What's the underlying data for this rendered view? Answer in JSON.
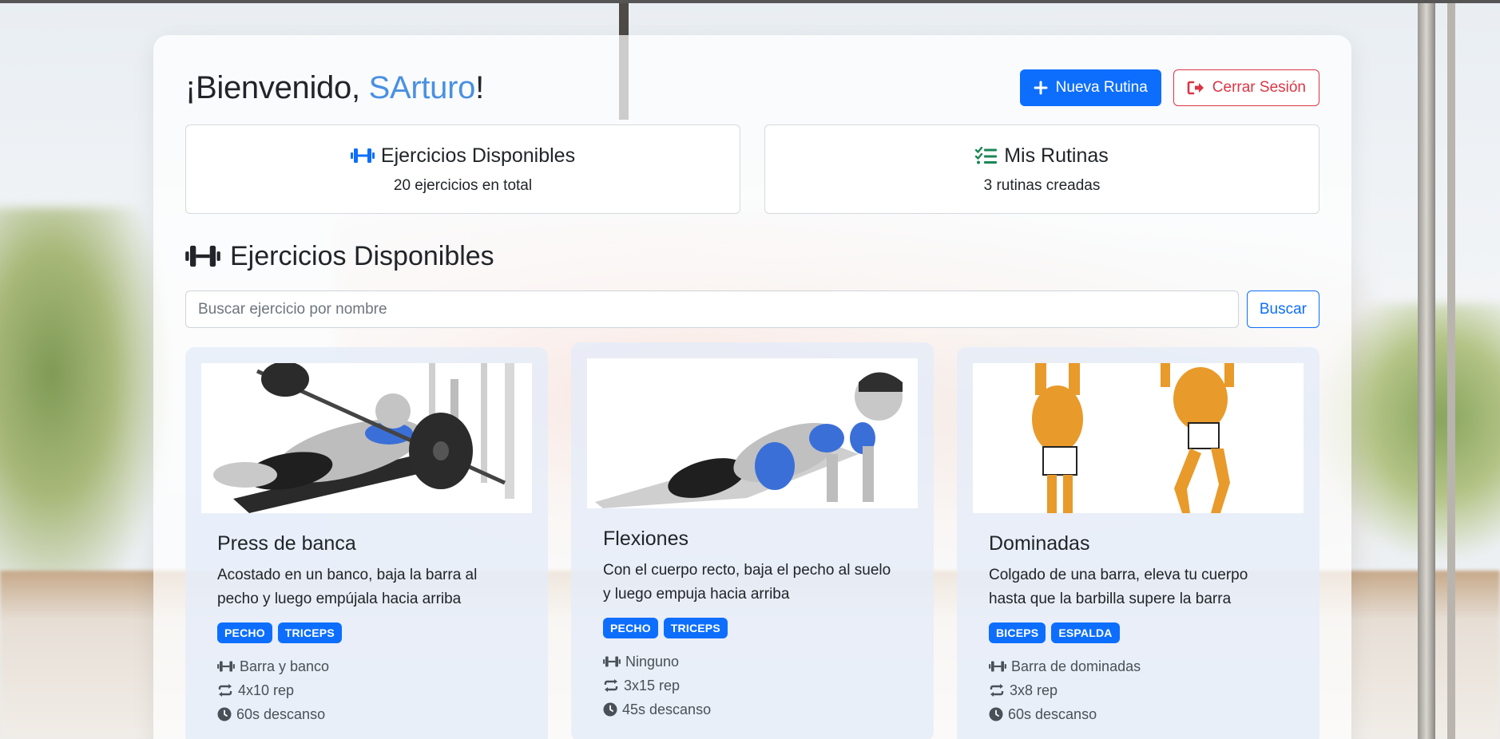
{
  "header": {
    "greeting": "¡Bienvenido, ",
    "username": "SArturo",
    "greeting_end": "!",
    "new_routine_label": "Nueva Rutina",
    "logout_label": "Cerrar Sesión"
  },
  "stats": [
    {
      "title": "Ejercicios Disponibles",
      "subtitle": "20 ejercicios en total",
      "icon": "dumbbell-icon"
    },
    {
      "title": "Mis Rutinas",
      "subtitle": "3 rutinas creadas",
      "icon": "list-check-icon"
    }
  ],
  "section": {
    "title": "Ejercicios Disponibles",
    "search_placeholder": "Buscar ejercicio por nombre",
    "search_button": "Buscar"
  },
  "exercises": [
    {
      "name": "Press de banca",
      "description": "Acostado en un banco, baja la barra al pecho y luego empújala hacia arriba",
      "tags": [
        "PECHO",
        "TRICEPS"
      ],
      "equipment": "Barra y banco",
      "sets": "4x10 rep",
      "rest": "60s descanso"
    },
    {
      "name": "Flexiones",
      "description": "Con el cuerpo recto, baja el pecho al suelo y luego empuja hacia arriba",
      "tags": [
        "PECHO",
        "TRICEPS"
      ],
      "equipment": "Ninguno",
      "sets": "3x15 rep",
      "rest": "45s descanso"
    },
    {
      "name": "Dominadas",
      "description": "Colgado de una barra, eleva tu cuerpo hasta que la barbilla supere la barra",
      "tags": [
        "BICEPS",
        "ESPALDA"
      ],
      "equipment": "Barra de dominadas",
      "sets": "3x8 rep",
      "rest": "60s descanso"
    }
  ],
  "colors": {
    "primary": "#0d6efd",
    "danger": "#dc3545",
    "username": "#4a90e2",
    "success_icon": "#198754"
  }
}
